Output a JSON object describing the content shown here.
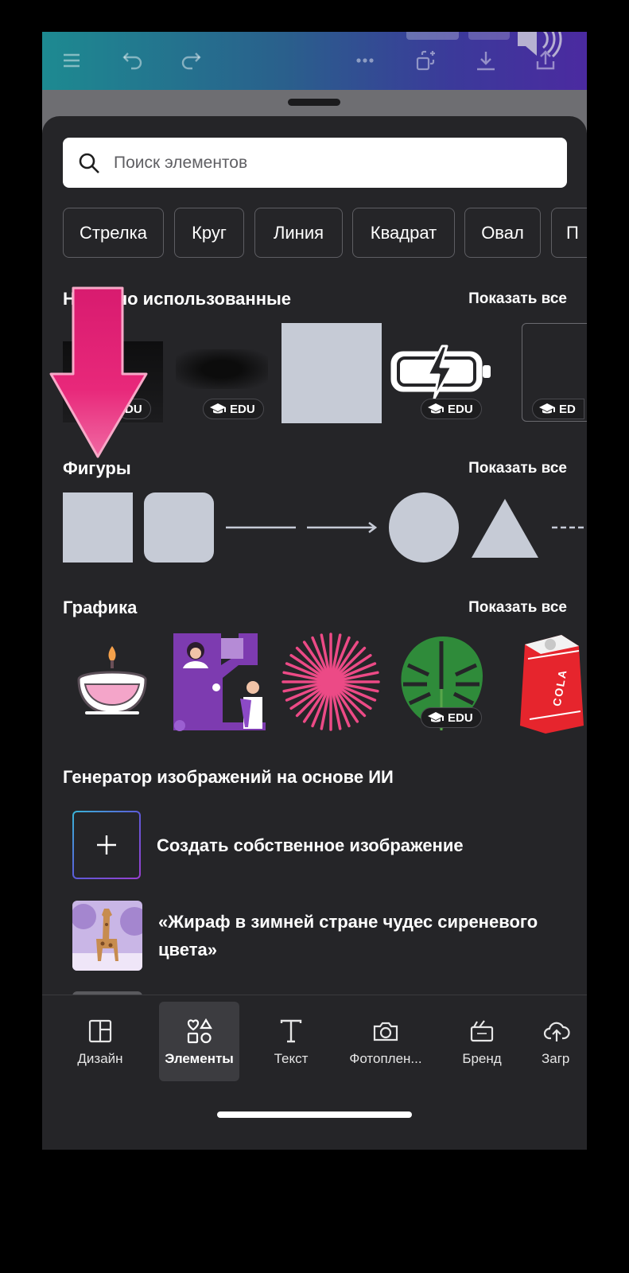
{
  "toolbar": {
    "icons": [
      "menu-icon",
      "undo-icon",
      "redo-icon",
      "more-icon",
      "magic-resize-icon",
      "download-icon",
      "share-icon"
    ],
    "volume_icon": "speaker-icon"
  },
  "search": {
    "placeholder": "Поиск элементов",
    "icon": "search-icon"
  },
  "chips": [
    "Стрелка",
    "Круг",
    "Линия",
    "Квадрат",
    "Овал",
    "П"
  ],
  "recent": {
    "title": "Недавно использованные",
    "title_visible": "Н      но использованные",
    "show_all": "Показать все",
    "badges": [
      "DU",
      "EDU",
      "EDU",
      "ED"
    ]
  },
  "shapes": {
    "title": "Фигуры",
    "show_all": "Показать все"
  },
  "graphics": {
    "title": "Графика",
    "show_all": "Показать все",
    "badge": "EDU",
    "cola_label": "COLA"
  },
  "ai": {
    "title": "Генератор изображений на основе ИИ",
    "create_label": "Создать собственное изображение",
    "prompt_label_line1": "«Жираф в зимней стране чудес сиреневого",
    "prompt_label_line2": "цвета»"
  },
  "bottom_nav": [
    {
      "label": "Дизайн",
      "icon": "layout-icon"
    },
    {
      "label": "Элементы",
      "icon": "shapes-icon",
      "active": true
    },
    {
      "label": "Текст",
      "icon": "text-icon"
    },
    {
      "label": "Фотоплен...",
      "icon": "camera-icon"
    },
    {
      "label": "Бренд",
      "icon": "brand-icon"
    },
    {
      "label": "Загр",
      "icon": "upload-icon"
    }
  ],
  "colors": {
    "accent_arrow": "#e8287a",
    "shape_fill": "#c6cbd6",
    "sheet_bg": "#252528"
  }
}
